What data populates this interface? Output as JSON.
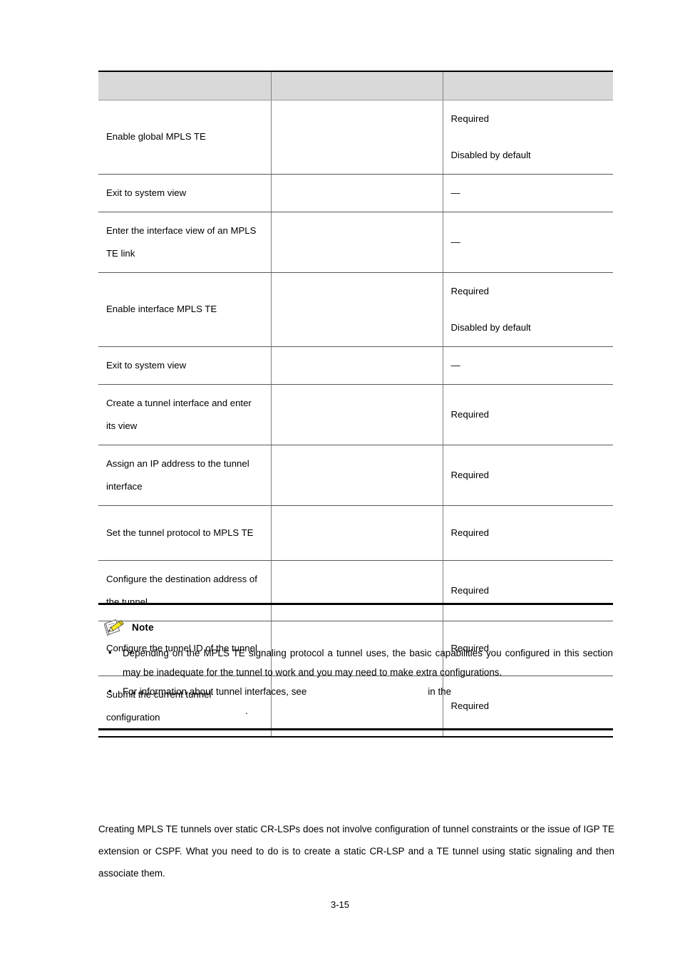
{
  "document": {
    "page_number": "3-15"
  },
  "table": {
    "headers": [
      "",
      "",
      ""
    ],
    "rows": [
      {
        "step": "Enable global MPLS TE",
        "command": "",
        "remarks": [
          "Required",
          "Disabled by default"
        ]
      },
      {
        "step": "Exit to system view",
        "command": "",
        "remarks": [
          "—"
        ]
      },
      {
        "step": "Enter the interface view of an MPLS TE link",
        "command": "",
        "remarks": [
          "—"
        ]
      },
      {
        "step": "Enable interface MPLS TE",
        "command": "",
        "remarks": [
          "Required",
          "Disabled by default"
        ]
      },
      {
        "step": "Exit to system view",
        "command": "",
        "remarks": [
          "—"
        ]
      },
      {
        "step": "Create a tunnel interface and enter its view",
        "command": "",
        "remarks": [
          "Required"
        ]
      },
      {
        "step": "Assign an IP address to the tunnel interface",
        "command": "",
        "remarks": [
          "Required"
        ]
      },
      {
        "step": "Set the tunnel protocol to MPLS TE",
        "command": "",
        "remarks": [
          "Required"
        ]
      },
      {
        "step": "Configure the destination address of the tunnel",
        "command": "",
        "remarks": [
          "Required"
        ]
      },
      {
        "step": "Configure the tunnel ID of the tunnel",
        "command": "",
        "remarks": [
          "Required"
        ]
      },
      {
        "step": "Submit the current tunnel configuration",
        "command": "",
        "remarks": [
          "Required"
        ]
      }
    ]
  },
  "note": {
    "title": "Note",
    "icon": "notepad-pencil-icon",
    "bullets": [
      "Depending on the MPLS TE signaling protocol a tunnel uses, the basic capabilities you configured in this section may be inadequate for the tunnel to work and you may need to make extra configurations.",
      {
        "before": "For information about tunnel interfaces, see",
        "xref": "",
        "middle": "in the",
        "xref2": "",
        "after": "."
      }
    ]
  },
  "section": {
    "heading": "",
    "paragraph": "Creating MPLS TE tunnels over static CR-LSPs does not involve configuration of tunnel constraints or the issue of IGP TE extension or CSPF. What you need to do is to create a static CR-LSP and a TE tunnel using static signaling and then associate them."
  },
  "colors": {
    "header_fill": "#d9d9d9",
    "rule": "#000000",
    "grid": "#808080",
    "note_icon_pencil": "#f2e21a",
    "text": "#000000"
  }
}
